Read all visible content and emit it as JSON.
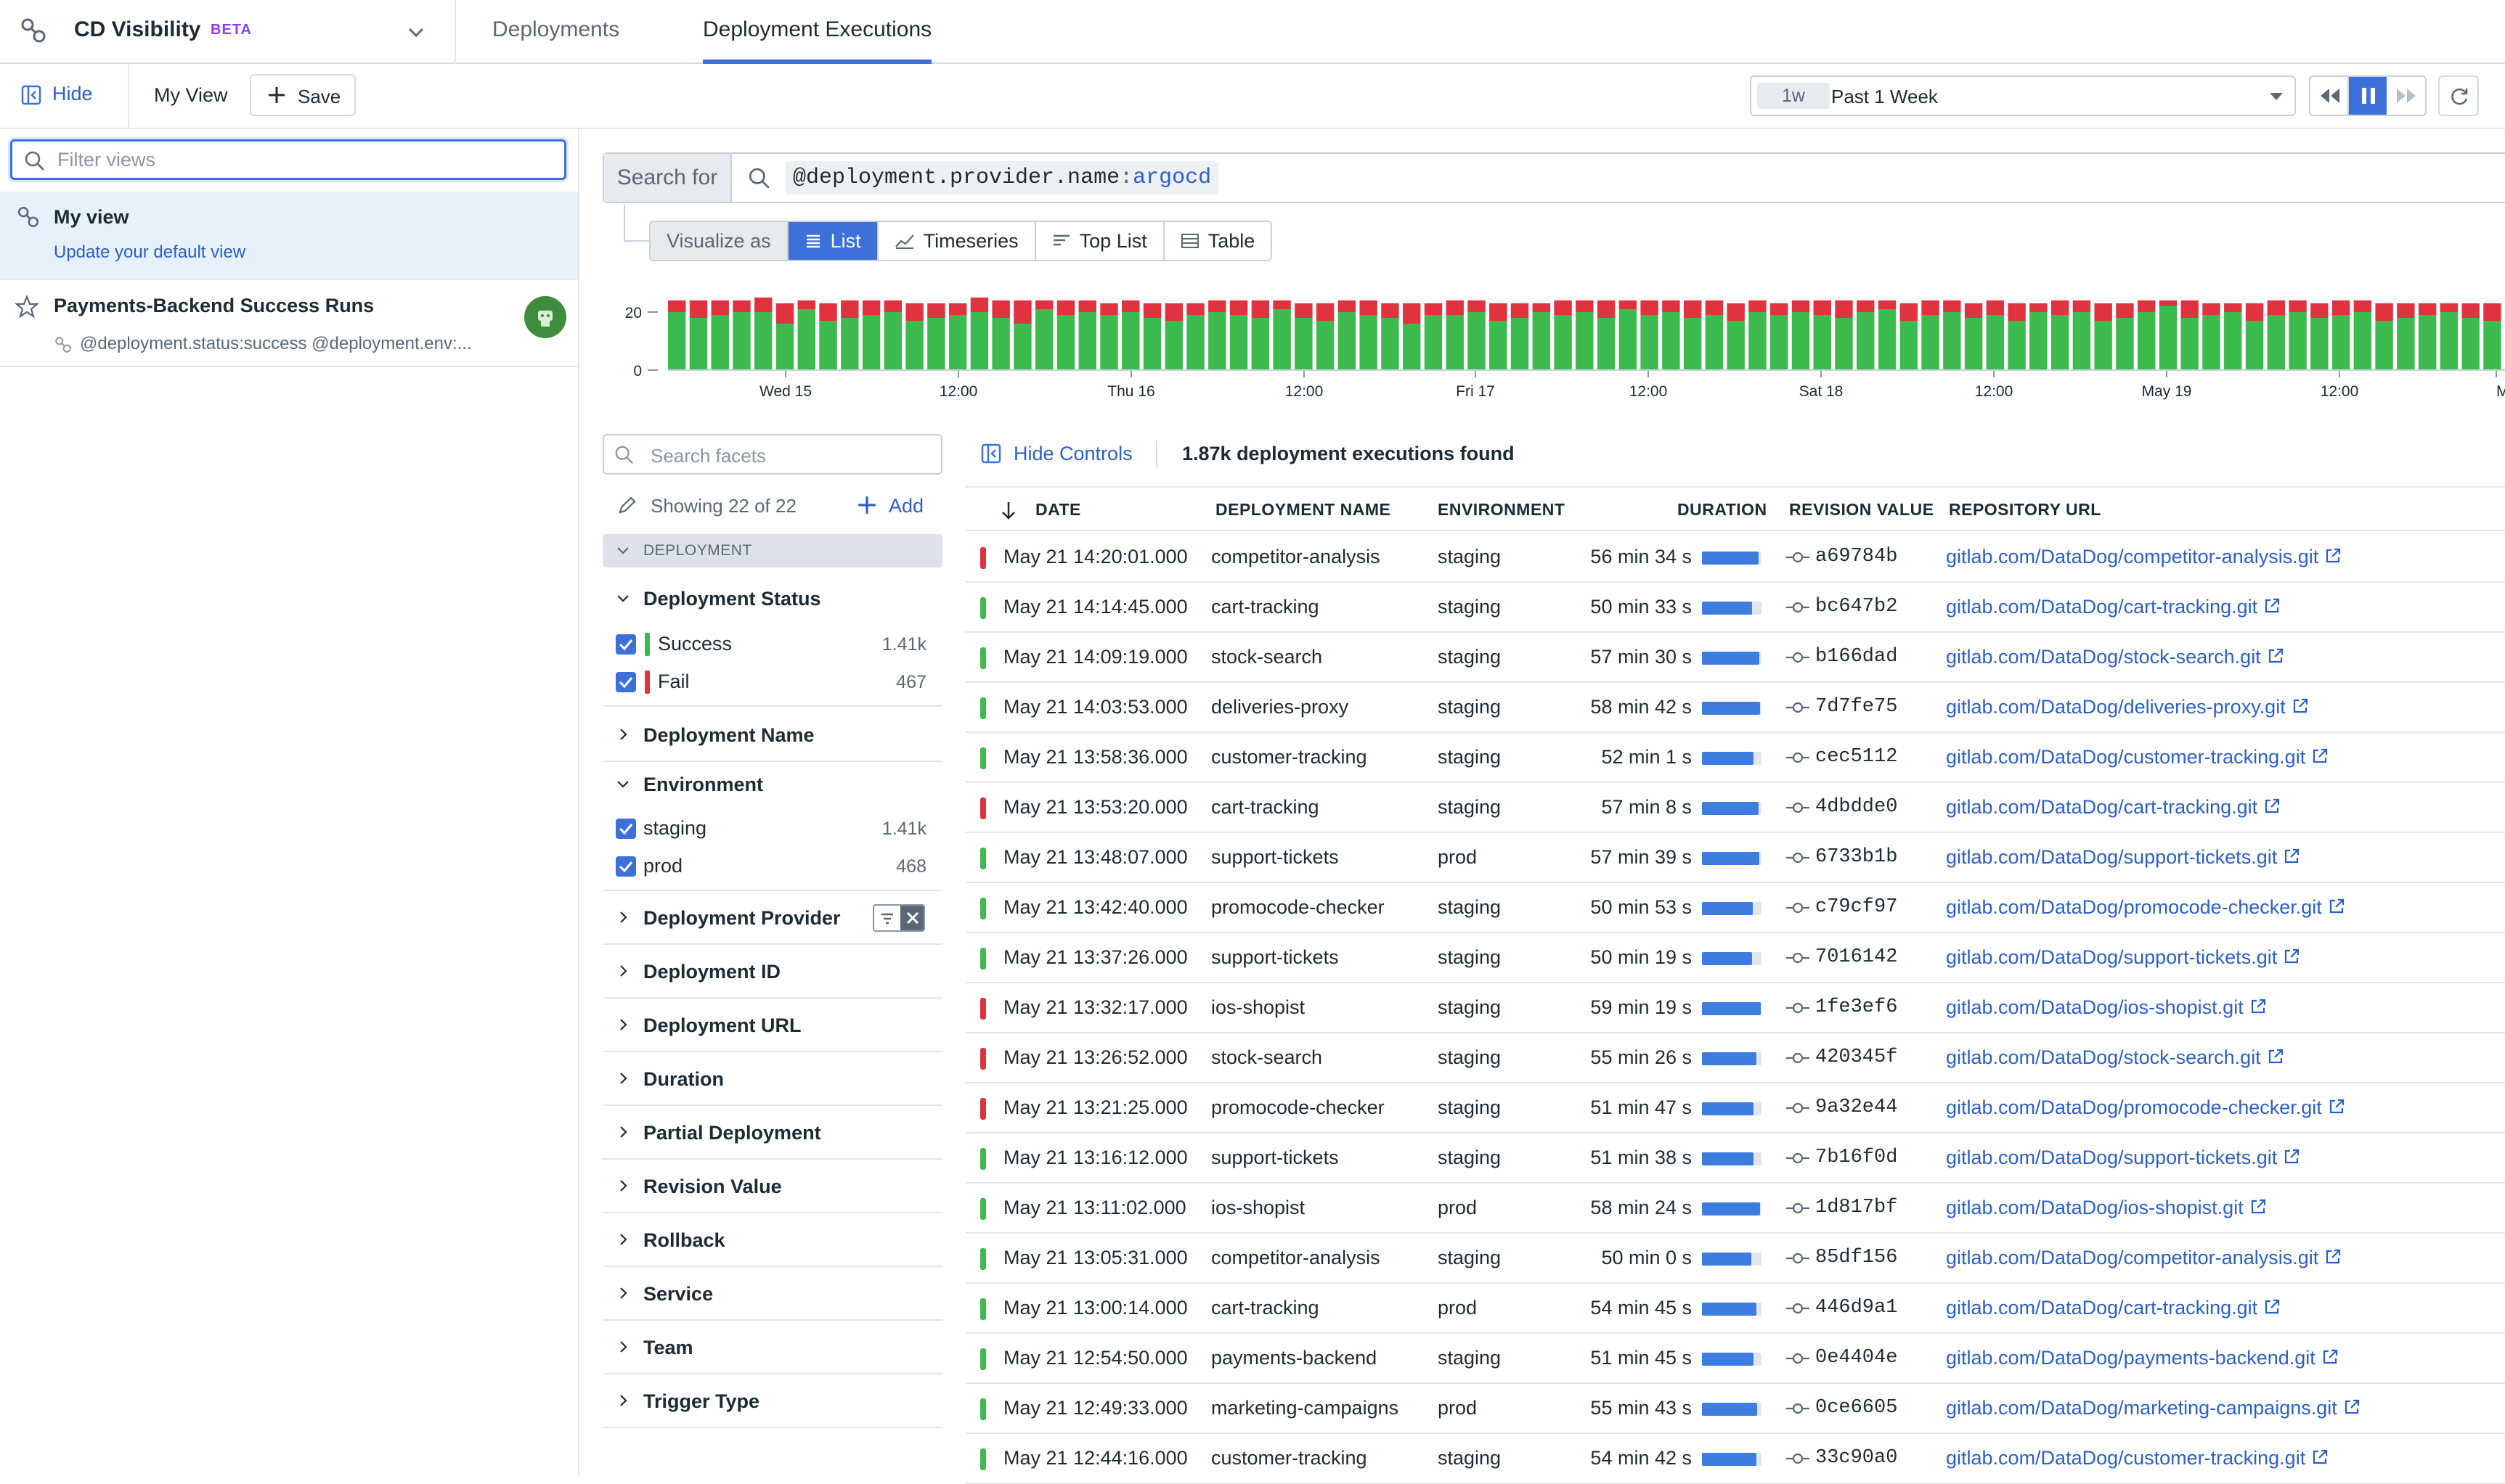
{
  "app": {
    "title": "CD Visibility",
    "badge": "BETA"
  },
  "tabs": [
    {
      "label": "Deployments"
    },
    {
      "label": "Deployment Executions"
    }
  ],
  "toolbar": {
    "hide_label": "Hide",
    "view_label": "My View",
    "save_label": "Save"
  },
  "time": {
    "badge": "1w",
    "label": "Past 1 Week"
  },
  "sidebar": {
    "filter_placeholder": "Filter views",
    "my_view": {
      "title": "My view",
      "link": "Update your default view"
    },
    "saved": {
      "title": "Payments-Backend Success Runs",
      "query": "@deployment.status:success @deployment.env:..."
    }
  },
  "search": {
    "prefix": "Search for",
    "query_key": "@deployment.provider.name",
    "query_sep": ":",
    "query_val": "argocd"
  },
  "visualize": {
    "label": "Visualize as",
    "options": [
      "List",
      "Timeseries",
      "Top List",
      "Table"
    ]
  },
  "chart_data": {
    "type": "bar",
    "stacked": true,
    "y_ticks": [
      "20",
      "0"
    ],
    "x_ticks": [
      "Wed 15",
      "12:00",
      "Thu 16",
      "12:00",
      "Fri 17",
      "12:00",
      "Sat 18",
      "12:00",
      "May 19",
      "12:00",
      "Mo"
    ],
    "series": [
      {
        "name": "Success",
        "color": "#3dba4e",
        "values": [
          20,
          18,
          19,
          20,
          20,
          16,
          21,
          17,
          18,
          19,
          20,
          17,
          18,
          19,
          20,
          18,
          16,
          21,
          19,
          20,
          19,
          20,
          18,
          17,
          19,
          20,
          19,
          18,
          21,
          18,
          17,
          20,
          19,
          18,
          16,
          19,
          19,
          20,
          17,
          18,
          20,
          19,
          20,
          18,
          21,
          19,
          20,
          18,
          19,
          17,
          20,
          19,
          20,
          19,
          18,
          20,
          21,
          17,
          19,
          20,
          18,
          19,
          17,
          20,
          19,
          20,
          17,
          18,
          20,
          22,
          18,
          19,
          20,
          17,
          19,
          20,
          18,
          19,
          20,
          17,
          18,
          19,
          20,
          18,
          17
        ]
      },
      {
        "name": "Fail",
        "color": "#e0323f",
        "values": [
          4,
          6,
          5,
          4,
          5,
          7,
          3,
          6,
          6,
          5,
          4,
          6,
          5,
          4,
          5,
          6,
          8,
          3,
          5,
          4,
          4,
          4,
          5,
          6,
          4,
          4,
          5,
          6,
          3,
          5,
          6,
          4,
          5,
          5,
          7,
          4,
          5,
          4,
          6,
          5,
          3,
          5,
          4,
          6,
          3,
          5,
          4,
          6,
          5,
          6,
          4,
          4,
          4,
          5,
          6,
          4,
          3,
          6,
          5,
          4,
          5,
          5,
          6,
          3,
          5,
          4,
          6,
          5,
          4,
          2,
          6,
          4,
          3,
          6,
          5,
          4,
          5,
          5,
          4,
          6,
          5,
          4,
          3,
          5,
          6
        ]
      }
    ]
  },
  "facets": {
    "search_placeholder": "Search facets",
    "showing": "Showing 22 of 22",
    "add": "Add",
    "group": "DEPLOYMENT",
    "status": {
      "name": "Deployment Status",
      "items": [
        {
          "label": "Success",
          "count": "1.41k",
          "color": "#3dba4e"
        },
        {
          "label": "Fail",
          "count": "467",
          "color": "#e0323f"
        }
      ]
    },
    "depname": "Deployment Name",
    "env": {
      "name": "Environment",
      "items": [
        {
          "label": "staging",
          "count": "1.41k"
        },
        {
          "label": "prod",
          "count": "468"
        }
      ]
    },
    "collapsed": [
      "Deployment Provider",
      "Deployment ID",
      "Deployment URL",
      "Duration",
      "Partial Deployment",
      "Revision Value",
      "Rollback",
      "Service",
      "Team",
      "Trigger Type"
    ]
  },
  "results": {
    "hide_controls": "Hide Controls",
    "count": "1.87k deployment executions found"
  },
  "table": {
    "headers": [
      "DATE",
      "DEPLOYMENT NAME",
      "ENVIRONMENT",
      "DURATION",
      "REVISION VALUE",
      "REPOSITORY URL"
    ],
    "rows": [
      {
        "status": "fail",
        "date": "May 21 14:20:01.000",
        "name": "competitor-analysis",
        "env": "staging",
        "duration": "56 min 34 s",
        "bar": 0.95,
        "rev": "a69784b",
        "url": "gitlab.com/DataDog/competitor-analysis.git"
      },
      {
        "status": "success",
        "date": "May 21 14:14:45.000",
        "name": "cart-tracking",
        "env": "staging",
        "duration": "50 min 33 s",
        "bar": 0.84,
        "rev": "bc647b2",
        "url": "gitlab.com/DataDog/cart-tracking.git"
      },
      {
        "status": "success",
        "date": "May 21 14:09:19.000",
        "name": "stock-search",
        "env": "staging",
        "duration": "57 min 30 s",
        "bar": 0.96,
        "rev": "b166dad",
        "url": "gitlab.com/DataDog/stock-search.git"
      },
      {
        "status": "success",
        "date": "May 21 14:03:53.000",
        "name": "deliveries-proxy",
        "env": "staging",
        "duration": "58 min 42 s",
        "bar": 0.98,
        "rev": "7d7fe75",
        "url": "gitlab.com/DataDog/deliveries-proxy.git"
      },
      {
        "status": "success",
        "date": "May 21 13:58:36.000",
        "name": "customer-tracking",
        "env": "staging",
        "duration": "52 min 1 s",
        "bar": 0.87,
        "rev": "cec5112",
        "url": "gitlab.com/DataDog/customer-tracking.git"
      },
      {
        "status": "fail",
        "date": "May 21 13:53:20.000",
        "name": "cart-tracking",
        "env": "staging",
        "duration": "57 min 8 s",
        "bar": 0.95,
        "rev": "4dbdde0",
        "url": "gitlab.com/DataDog/cart-tracking.git"
      },
      {
        "status": "success",
        "date": "May 21 13:48:07.000",
        "name": "support-tickets",
        "env": "prod",
        "duration": "57 min 39 s",
        "bar": 0.96,
        "rev": "6733b1b",
        "url": "gitlab.com/DataDog/support-tickets.git"
      },
      {
        "status": "success",
        "date": "May 21 13:42:40.000",
        "name": "promocode-checker",
        "env": "staging",
        "duration": "50 min 53 s",
        "bar": 0.85,
        "rev": "c79cf97",
        "url": "gitlab.com/DataDog/promocode-checker.git"
      },
      {
        "status": "success",
        "date": "May 21 13:37:26.000",
        "name": "support-tickets",
        "env": "staging",
        "duration": "50 min 19 s",
        "bar": 0.84,
        "rev": "7016142",
        "url": "gitlab.com/DataDog/support-tickets.git"
      },
      {
        "status": "fail",
        "date": "May 21 13:32:17.000",
        "name": "ios-shopist",
        "env": "staging",
        "duration": "59 min 19 s",
        "bar": 0.99,
        "rev": "1fe3ef6",
        "url": "gitlab.com/DataDog/ios-shopist.git"
      },
      {
        "status": "fail",
        "date": "May 21 13:26:52.000",
        "name": "stock-search",
        "env": "staging",
        "duration": "55 min 26 s",
        "bar": 0.92,
        "rev": "420345f",
        "url": "gitlab.com/DataDog/stock-search.git"
      },
      {
        "status": "fail",
        "date": "May 21 13:21:25.000",
        "name": "promocode-checker",
        "env": "staging",
        "duration": "51 min 47 s",
        "bar": 0.86,
        "rev": "9a32e44",
        "url": "gitlab.com/DataDog/promocode-checker.git"
      },
      {
        "status": "success",
        "date": "May 21 13:16:12.000",
        "name": "support-tickets",
        "env": "staging",
        "duration": "51 min 38 s",
        "bar": 0.86,
        "rev": "7b16f0d",
        "url": "gitlab.com/DataDog/support-tickets.git"
      },
      {
        "status": "success",
        "date": "May 21 13:11:02.000",
        "name": "ios-shopist",
        "env": "prod",
        "duration": "58 min 24 s",
        "bar": 0.97,
        "rev": "1d817bf",
        "url": "gitlab.com/DataDog/ios-shopist.git"
      },
      {
        "status": "success",
        "date": "May 21 13:05:31.000",
        "name": "competitor-analysis",
        "env": "staging",
        "duration": "50 min 0 s",
        "bar": 0.83,
        "rev": "85df156",
        "url": "gitlab.com/DataDog/competitor-analysis.git"
      },
      {
        "status": "success",
        "date": "May 21 13:00:14.000",
        "name": "cart-tracking",
        "env": "prod",
        "duration": "54 min 45 s",
        "bar": 0.91,
        "rev": "446d9a1",
        "url": "gitlab.com/DataDog/cart-tracking.git"
      },
      {
        "status": "success",
        "date": "May 21 12:54:50.000",
        "name": "payments-backend",
        "env": "staging",
        "duration": "51 min 45 s",
        "bar": 0.86,
        "rev": "0e4404e",
        "url": "gitlab.com/DataDog/payments-backend.git"
      },
      {
        "status": "success",
        "date": "May 21 12:49:33.000",
        "name": "marketing-campaigns",
        "env": "prod",
        "duration": "55 min 43 s",
        "bar": 0.93,
        "rev": "0ce6605",
        "url": "gitlab.com/DataDog/marketing-campaigns.git"
      },
      {
        "status": "success",
        "date": "May 21 12:44:16.000",
        "name": "customer-tracking",
        "env": "staging",
        "duration": "54 min 42 s",
        "bar": 0.91,
        "rev": "33c90a0",
        "url": "gitlab.com/DataDog/customer-tracking.git"
      }
    ]
  },
  "colors": {
    "accent": "#3d71d9",
    "success": "#3dba4e",
    "fail": "#e0323f",
    "link": "#2b5fc9"
  }
}
